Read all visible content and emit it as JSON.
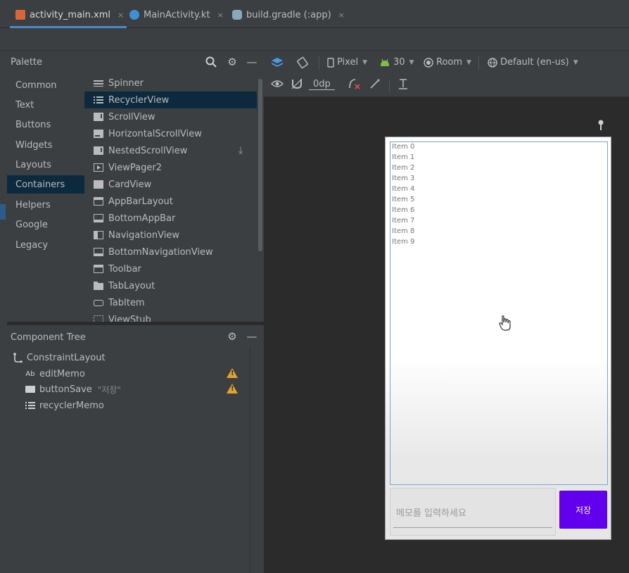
{
  "tabs": [
    {
      "label": "activity_main.xml",
      "close": "×",
      "active": true,
      "icon_color": "#d9653b"
    },
    {
      "label": "MainActivity.kt",
      "close": "×",
      "active": false,
      "icon_color": "#3d8fd9"
    },
    {
      "label": "build.gradle (:app)",
      "close": "×",
      "active": false,
      "icon_color": "#8aa9b8"
    }
  ],
  "palette": {
    "title": "Palette",
    "categories": [
      "Common",
      "Text",
      "Buttons",
      "Widgets",
      "Layouts",
      "Containers",
      "Helpers",
      "Google",
      "Legacy"
    ],
    "selected_category": "Containers",
    "widgets": [
      "Spinner",
      "RecyclerView",
      "ScrollView",
      "HorizontalScrollView",
      "NestedScrollView",
      "ViewPager2",
      "CardView",
      "AppBarLayout",
      "BottomAppBar",
      "NavigationView",
      "BottomNavigationView",
      "Toolbar",
      "TabLayout",
      "TabItem",
      "ViewStub"
    ],
    "selected_widget": "RecyclerView"
  },
  "component_tree": {
    "title": "Component Tree",
    "root": "ConstraintLayout",
    "items": [
      {
        "label": "editMemo",
        "icon": "Ab",
        "warning": true,
        "hint": ""
      },
      {
        "label": "buttonSave",
        "icon": "button-icon",
        "warning": true,
        "hint": "\"저장\""
      },
      {
        "label": "recyclerMemo",
        "icon": "list-icon",
        "warning": false,
        "hint": ""
      }
    ]
  },
  "toolbar": {
    "device": "Pixel",
    "api": "30",
    "theme": "Room",
    "locale": "Default (en-us)",
    "margin": "0dp"
  },
  "preview": {
    "items": [
      "Item 0",
      "Item 1",
      "Item 2",
      "Item 3",
      "Item 4",
      "Item 5",
      "Item 6",
      "Item 7",
      "Item 8",
      "Item 9"
    ],
    "edit_hint": "메모를 입력하세요",
    "button_label": "저장",
    "button_color": "#6200ee"
  }
}
